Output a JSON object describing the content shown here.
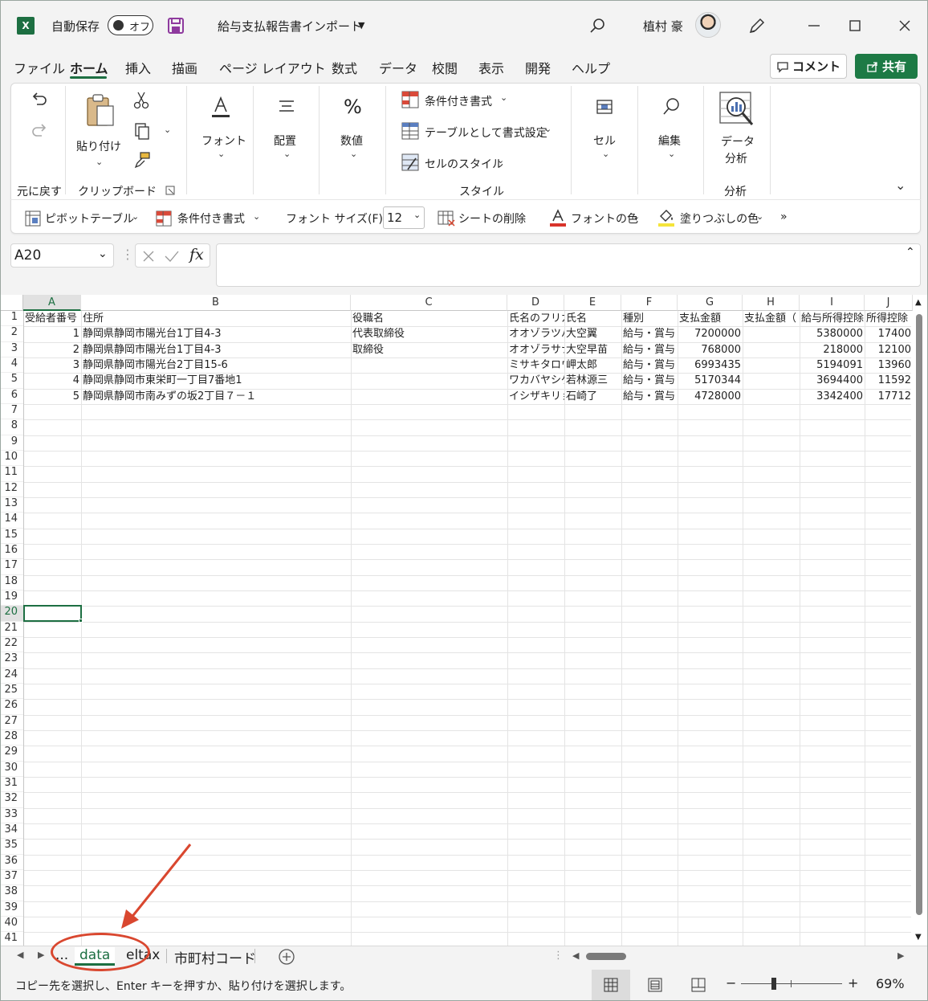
{
  "titlebar": {
    "app_icon": "excel-logo",
    "autosave_label": "自動保存",
    "autosave_state": "オフ",
    "doc_title": "給与支払報告書インポート",
    "user_name": "植村 豪"
  },
  "menu": {
    "tabs": [
      "ファイル",
      "ホーム",
      "挿入",
      "描画",
      "ページ レイアウト",
      "数式",
      "データ",
      "校閲",
      "表示",
      "開発",
      "ヘルプ"
    ],
    "active": "ホーム",
    "comment_label": "コメント",
    "share_label": "共有"
  },
  "ribbon": {
    "paste_label": "貼り付け",
    "undo_group_label": "元に戻す",
    "clipboard_group_label": "クリップボード",
    "font_label": "フォント",
    "align_label": "配置",
    "number_label": "数値",
    "cond_format_label": "条件付き書式",
    "table_format_label": "テーブルとして書式設定",
    "cell_style_label": "セルのスタイル",
    "style_group_label": "スタイル",
    "cell_label": "セル",
    "edit_label": "編集",
    "analysis_label_1": "データ",
    "analysis_label_2": "分析",
    "analysis_group_label": "分析"
  },
  "qat": {
    "pivot_label": "ピボットテーブル",
    "cond_format_label": "条件付き書式",
    "font_size_label": "フォント サイズ(F):",
    "font_size_value": "12",
    "delete_sheet_label": "シートの削除",
    "font_color_label": "フォントの色",
    "fill_color_label": "塗りつぶしの色",
    "more_label": "»"
  },
  "formula": {
    "name_box": "A20",
    "fx": "fx",
    "value": ""
  },
  "grid": {
    "columns": [
      "A",
      "B",
      "C",
      "D",
      "E",
      "F",
      "G",
      "H",
      "I",
      "J"
    ],
    "selected_column": "A",
    "row_numbers": [
      "1",
      "2",
      "3",
      "4",
      "5",
      "6",
      "7",
      "8",
      "9",
      "10",
      "11",
      "12",
      "13",
      "14",
      "15",
      "16",
      "17",
      "18",
      "19",
      "20",
      "21",
      "22",
      "23",
      "24",
      "25",
      "26",
      "27",
      "28",
      "29",
      "30",
      "31",
      "32",
      "33",
      "34",
      "35",
      "36",
      "37",
      "38",
      "39",
      "40",
      "41"
    ],
    "selected_row": "20",
    "header_row": [
      "受給者番号",
      "住所",
      "役職名",
      "氏名のフリガナ",
      "氏名",
      "種別",
      "支払金額",
      "支払金額（",
      "給与所得控除",
      "所得控除"
    ],
    "rows": [
      [
        "1",
        "静岡県静岡市陽光台1丁目4-3",
        "代表取締役",
        "オオゾラツバサ",
        "大空翼",
        "給与・賞与",
        "7200000",
        "",
        "5380000",
        "17400"
      ],
      [
        "2",
        "静岡県静岡市陽光台1丁目4-3",
        "取締役",
        "オオゾラサナエ",
        "大空早苗",
        "給与・賞与",
        "768000",
        "",
        "218000",
        "12100"
      ],
      [
        "3",
        "静岡県静岡市陽光台2丁目15-6",
        "",
        "ミサキタロウ",
        "岬太郎",
        "給与・賞与",
        "6993435",
        "",
        "5194091",
        "13960"
      ],
      [
        "4",
        "静岡県静岡市東栄町一丁目7番地1",
        "",
        "ワカバヤシゲンゾウ",
        "若林源三",
        "給与・賞与",
        "5170344",
        "",
        "3694400",
        "11592"
      ],
      [
        "5",
        "静岡県静岡市南みずの坂2丁目７－１",
        "",
        "イシザキリョウ",
        "石崎了",
        "給与・賞与",
        "4728000",
        "",
        "3342400",
        "17712"
      ]
    ]
  },
  "sheet_tabs": {
    "ellipsis": "...",
    "tabs": [
      "data",
      "eltax",
      "市町村コード"
    ],
    "active": "data"
  },
  "status": {
    "message": "コピー先を選択し、Enter キーを押すか、貼り付けを選択します。",
    "zoom": "69%"
  },
  "colors": {
    "accent": "#1d6f42",
    "annotation": "#d9472f"
  }
}
